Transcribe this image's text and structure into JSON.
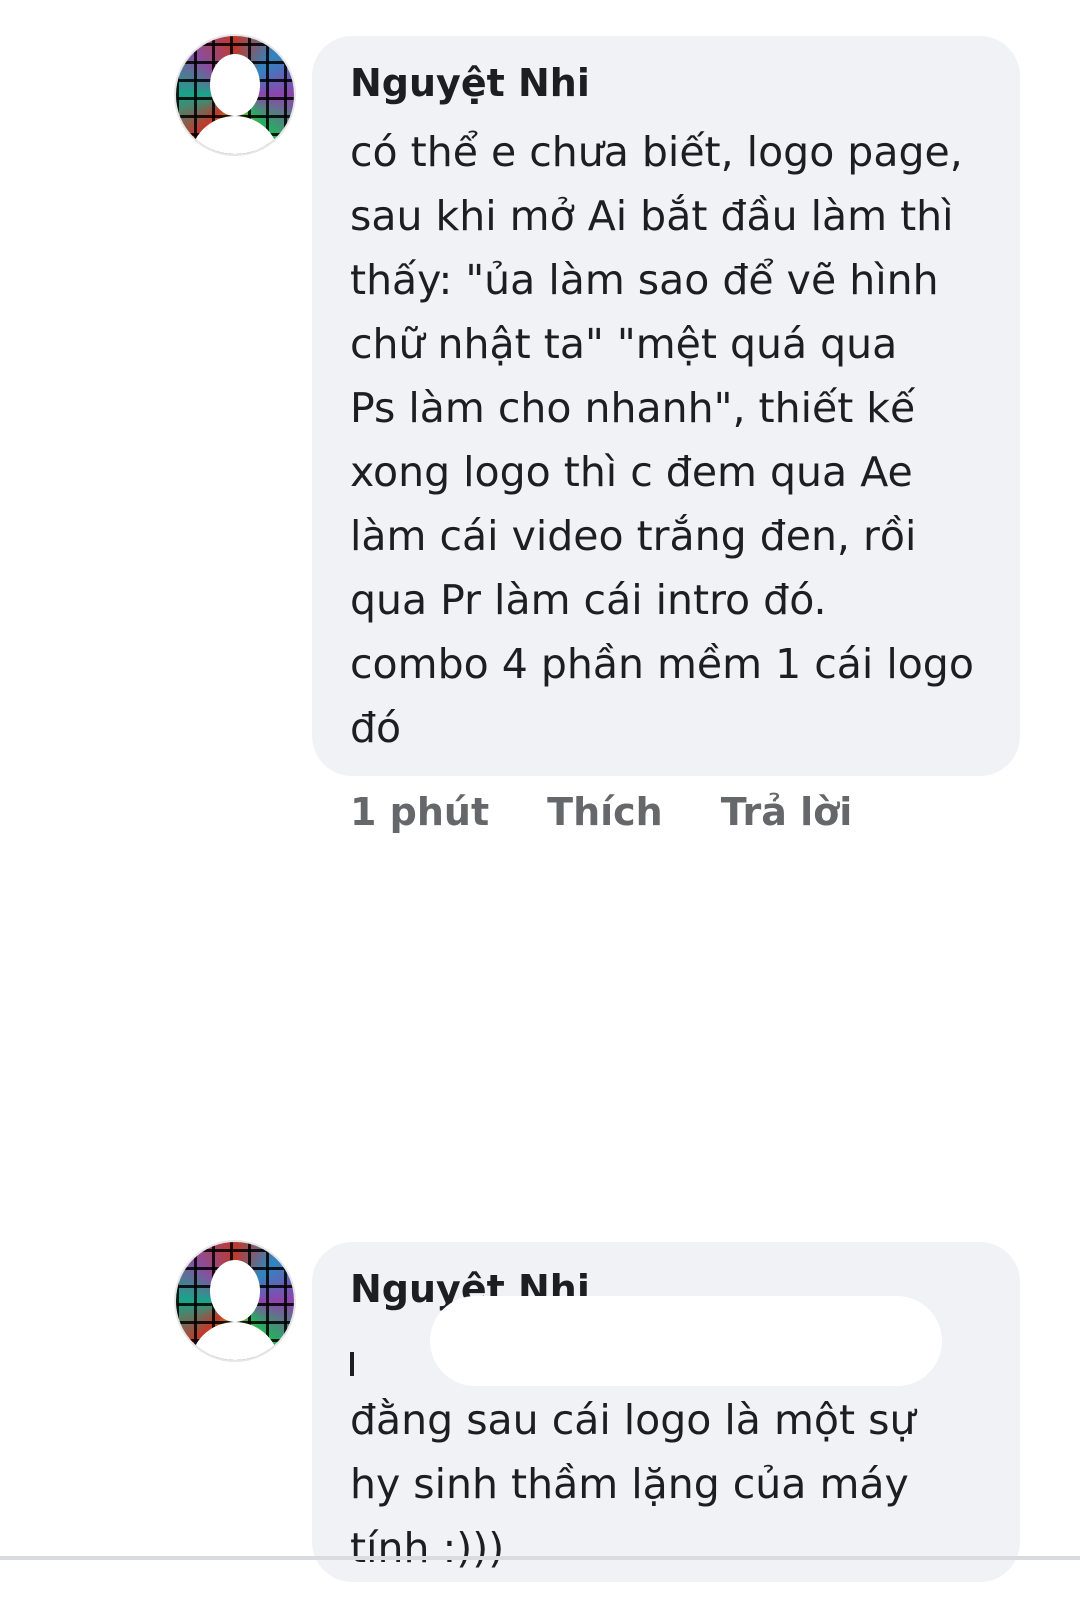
{
  "comments": [
    {
      "author": "Nguyệt Nhi",
      "lines": [
        "có thể e chưa biết, logo page,",
        "sau khi mở Ai bắt đầu làm thì",
        "thấy: \"ủa làm sao để vẽ hình",
        "chữ nhật ta\" \"mệt quá qua",
        "Ps làm cho nhanh\", thiết kế",
        "xong logo thì c đem qua Ae",
        "làm cái video trắng đen, rồi",
        "qua Pr làm cái intro đó.",
        "combo 4 phần mềm 1 cái logo",
        "đó"
      ],
      "actions": {
        "time": "1 phút",
        "like": "Thích",
        "reply": "Trả lời"
      }
    },
    {
      "author": "Nguyệt Nhi",
      "lines": [
        "đằng sau cái logo là một sự",
        "hy sinh thầm lặng của máy",
        "tính :)))"
      ]
    }
  ],
  "colors": {
    "bubble": "#f0f2f5",
    "text": "#1c1e21",
    "meta": "#65676b"
  }
}
